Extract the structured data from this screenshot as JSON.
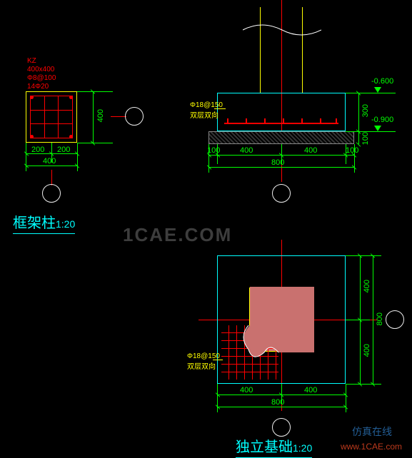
{
  "column": {
    "label": "KZ\n400x400\nΦ8@100\n14Φ20",
    "dims": {
      "h_seg1": "200",
      "h_seg2": "200",
      "h_total": "400",
      "v_seg": "400"
    },
    "title": "框架柱",
    "scale": "1:20"
  },
  "foundation_section": {
    "rebar_note": "Φ18@150\n双层双向",
    "dims": {
      "left": "100",
      "mid1": "400",
      "mid2": "400",
      "right": "100",
      "total": "800",
      "v1": "300",
      "v2": "100"
    },
    "elev1": "-0.600",
    "elev2": "-0.900"
  },
  "foundation_plan": {
    "rebar_note": "Φ18@150\n双层双向",
    "dims": {
      "h1": "400",
      "h2": "400",
      "h_total": "800",
      "v1": "400",
      "v2": "400",
      "v_total": "800"
    },
    "title": "独立基础",
    "scale": "1:20"
  },
  "watermark": "1CAE.COM",
  "watermark2": "仿真在线",
  "watermark3": "www.1CAE.com"
}
